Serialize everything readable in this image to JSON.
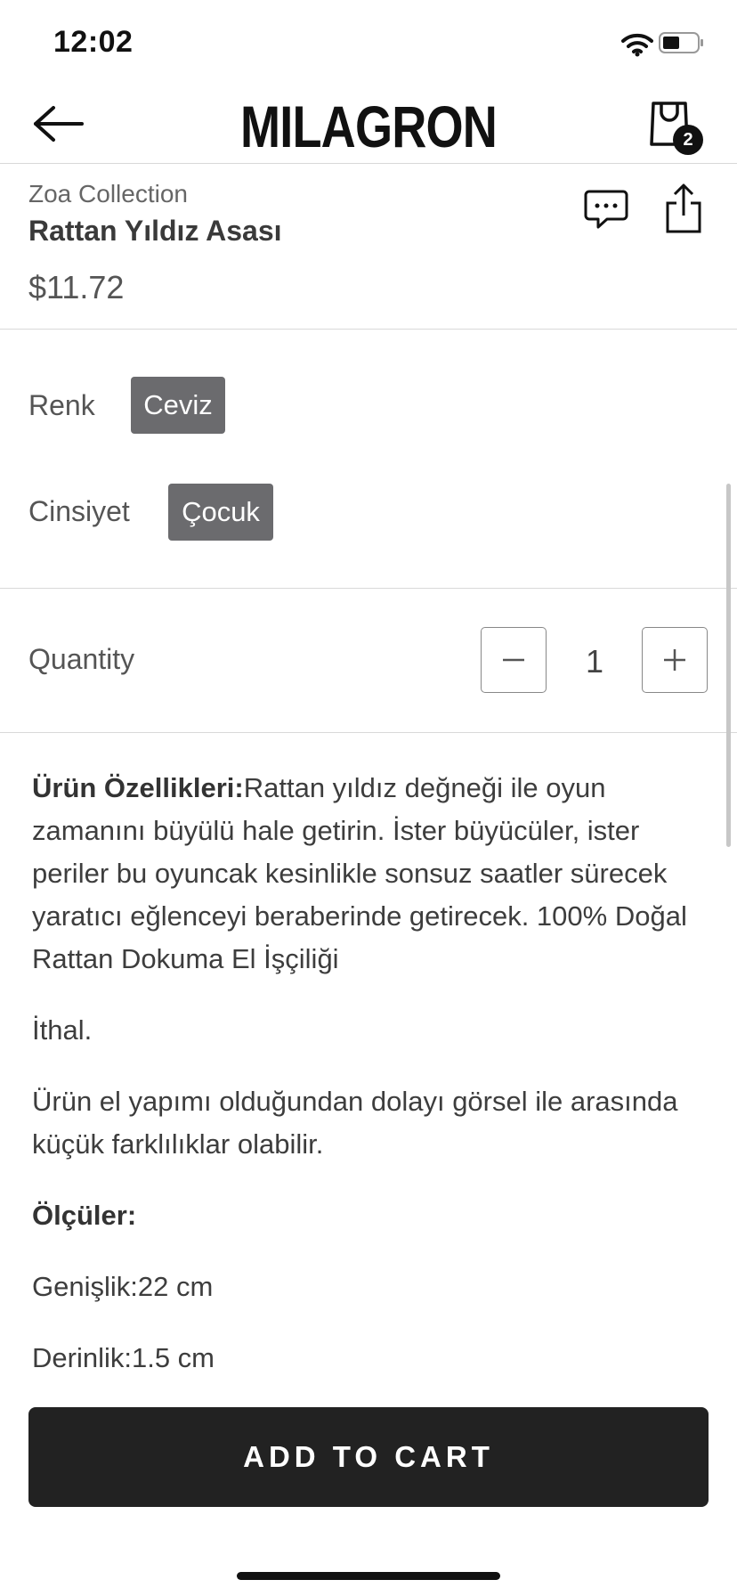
{
  "status": {
    "time": "12:02"
  },
  "header": {
    "logo": "MILAGRON",
    "cart_count": "2"
  },
  "product": {
    "collection": "Zoa Collection",
    "name": "Rattan Yıldız Asası",
    "price": "$11.72"
  },
  "options": {
    "color_label": "Renk",
    "color_value": "Ceviz",
    "gender_label": "Cinsiyet",
    "gender_value": "Çocuk"
  },
  "quantity": {
    "label": "Quantity",
    "value": "1"
  },
  "description": {
    "features_title": "Ürün Özellikleri:",
    "features_text": "Rattan yıldız değneği ile oyun zamanını büyülü hale getirin. İster büyücüler, ister periler bu oyuncak kesinlikle sonsuz saatler sürecek yaratıcı eğlenceyi beraberinde getirecek. 100% Doğal Rattan Dokuma El İşçiliği",
    "imported": "İthal.",
    "handmade_note": "Ürün el yapımı olduğundan dolayı görsel ile arasında küçük farklılıklar olabilir.",
    "dimensions_title": "Ölçüler:",
    "width": "Genişlik:22 cm",
    "depth": "Derinlik:1.5 cm"
  },
  "actions": {
    "add_to_cart": "ADD TO CART"
  },
  "icons": [
    "wifi-icon",
    "battery-icon",
    "back-arrow-icon",
    "shopping-bag-icon",
    "chat-icon",
    "share-icon",
    "minus-icon",
    "plus-icon"
  ]
}
